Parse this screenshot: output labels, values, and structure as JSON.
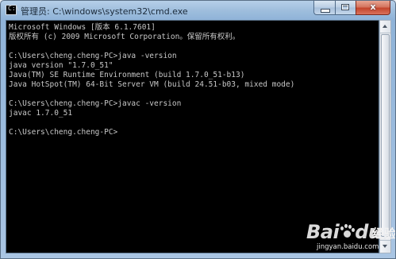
{
  "window": {
    "title": "管理员: C:\\windows\\system32\\cmd.exe",
    "controls": {
      "minimize_icon": "minimize-icon",
      "maximize_icon": "maximize-icon",
      "close_icon": "close-icon",
      "close_glyph": "x"
    }
  },
  "console": {
    "lines": [
      "Microsoft Windows [版本 6.1.7601]",
      "版权所有 (c) 2009 Microsoft Corporation。保留所有权利。",
      "",
      "C:\\Users\\cheng.cheng-PC>java -version",
      "java version \"1.7.0_51\"",
      "Java(TM) SE Runtime Environment (build 1.7.0_51-b13)",
      "Java HotSpot(TM) 64-Bit Server VM (build 24.51-b03, mixed mode)",
      "",
      "C:\\Users\\cheng.cheng-PC>javac -version",
      "javac 1.7.0_51",
      "",
      "C:\\Users\\cheng.cheng-PC>"
    ],
    "background": "#000000",
    "foreground": "#c8c8c8"
  },
  "watermark": {
    "logo_left": "Bai",
    "logo_right": "du",
    "text": "经验",
    "url": "jingyan.baidu.com"
  },
  "colors": {
    "titlebar": "#9fbedd",
    "close_button": "#c4452c"
  }
}
